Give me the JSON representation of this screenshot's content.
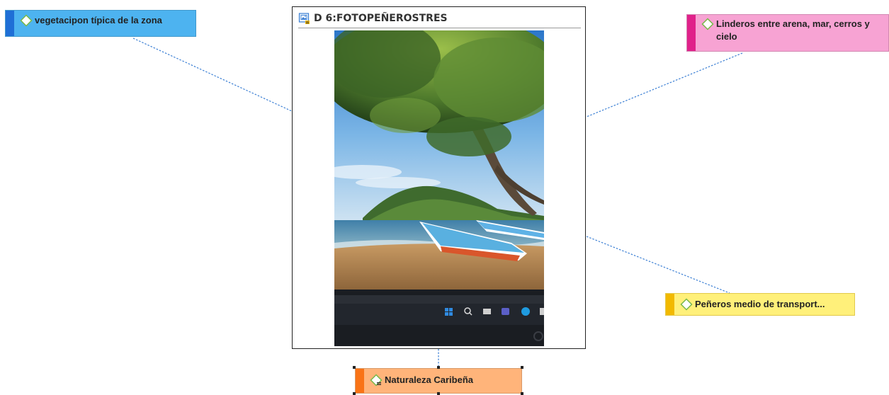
{
  "document": {
    "title": "D 6:FOTOPEÑEROSTRES"
  },
  "codes": {
    "vegetacion": {
      "label": "vegetacipon típica de la zona",
      "fill": "#4db3f0",
      "stripe": "#1f6fd6"
    },
    "linderos": {
      "label": "Linderos entre arena, mar, cerros y cielo",
      "fill": "#f7a3d3",
      "stripe": "#e0218a"
    },
    "peneros": {
      "label": "Peñeros medio de transport...",
      "fill": "#fff07a",
      "stripe": "#f2b900"
    },
    "naturaleza": {
      "label": "Naturaleza Caribeña",
      "fill": "#ffb47a",
      "stripe": "#f97316",
      "selected": true
    }
  },
  "connector_color": "#3b7fd4",
  "icons": {
    "code": "code-diamond-icon",
    "document": "image-document-icon",
    "taskbar": [
      "windows-start-icon",
      "search-icon",
      "file-explorer-icon",
      "teams-icon",
      "edge-icon"
    ]
  }
}
